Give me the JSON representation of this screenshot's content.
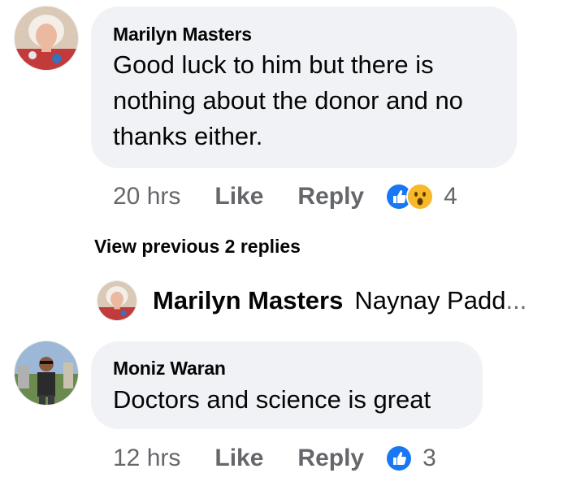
{
  "comments": [
    {
      "author": "Marilyn Masters",
      "avatar_icon": "profile-photo-woman",
      "lines": [
        "Good luck to him but there is",
        "nothing about the donor and no",
        "thanks either."
      ],
      "time": "20 hrs",
      "like_label": "Like",
      "reply_label": "Reply",
      "reactions": [
        "like-icon",
        "wow-icon"
      ],
      "reaction_count": "4"
    },
    {
      "author": "Moniz Waran",
      "avatar_icon": "profile-photo-man",
      "lines": [
        "Doctors and science is great"
      ],
      "time": "12 hrs",
      "like_label": "Like",
      "reply_label": "Reply",
      "reactions": [
        "like-icon"
      ],
      "reaction_count": "3"
    }
  ],
  "view_previous": "View previous 2 replies",
  "reply_preview": {
    "author": "Marilyn Masters",
    "text": "Naynay Padd",
    "ellipsis": "..."
  },
  "colors": {
    "bubble": "#f0f2f5",
    "meta_text": "#65676b",
    "like_blue": "#1877f2",
    "wow_yellow": "#f7b928"
  }
}
